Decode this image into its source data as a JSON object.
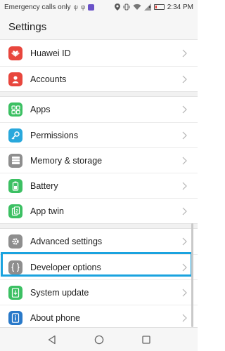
{
  "status_bar": {
    "carrier_text": "Emergency calls only",
    "time": "2:34 PM",
    "battery_level_fraction": 0.2,
    "accent_color": "#e53935"
  },
  "header": {
    "title": "Settings"
  },
  "groups": [
    [
      {
        "label": "Huawei ID",
        "icon": "huawei-logo-icon",
        "color": "#e8463d"
      },
      {
        "label": "Accounts",
        "icon": "account-icon",
        "color": "#e8463d"
      }
    ],
    [
      {
        "label": "Apps",
        "icon": "apps-grid-icon",
        "color": "#3cc063"
      },
      {
        "label": "Permissions",
        "icon": "key-icon",
        "color": "#29a8dc"
      },
      {
        "label": "Memory & storage",
        "icon": "storage-icon",
        "color": "#8e8e8e"
      },
      {
        "label": "Battery",
        "icon": "battery-icon",
        "color": "#3cc063"
      },
      {
        "label": "App twin",
        "icon": "app-twin-icon",
        "color": "#3cc063"
      }
    ],
    [
      {
        "label": "Advanced settings",
        "icon": "gear-icon",
        "color": "#8e8e8e"
      },
      {
        "label": "Developer options",
        "icon": "braces-icon",
        "color": "#8e8e8e",
        "highlighted": true
      },
      {
        "label": "System update",
        "icon": "system-update-icon",
        "color": "#3cc063"
      },
      {
        "label": "About phone",
        "icon": "phone-info-icon",
        "color": "#2979c9"
      }
    ]
  ],
  "highlight_color": "#1aa3df",
  "nav": {
    "back": "back-icon",
    "home": "home-icon",
    "recents": "recents-icon"
  }
}
